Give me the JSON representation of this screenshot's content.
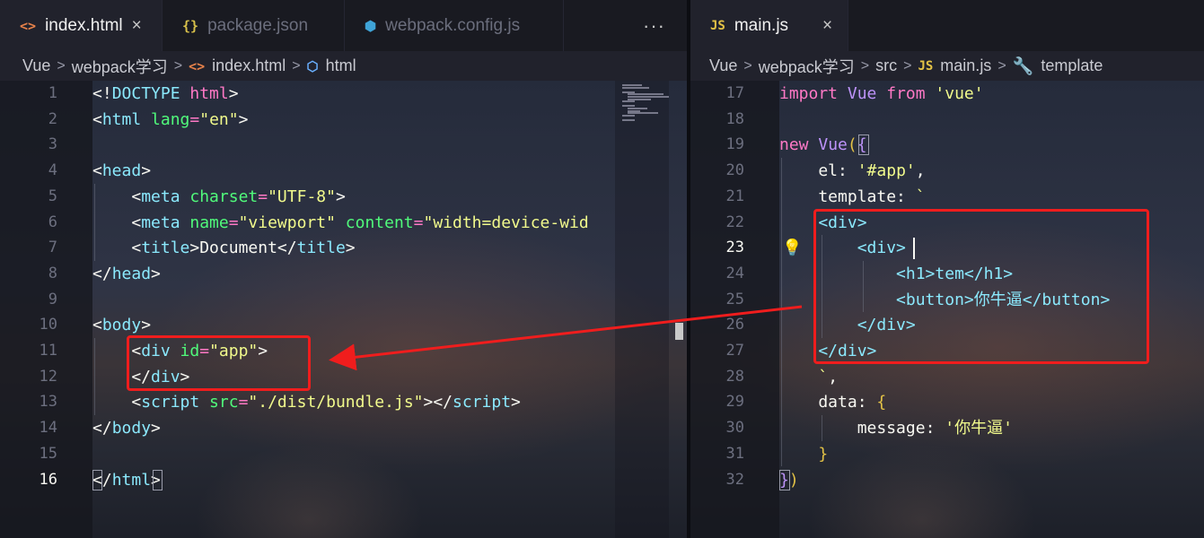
{
  "left": {
    "tabs": [
      {
        "label": "index.html",
        "icon": "<>",
        "icon_name": "html-file-icon",
        "active": true,
        "close": "×"
      },
      {
        "label": "package.json",
        "icon": "{}",
        "icon_name": "json-file-icon",
        "active": false
      },
      {
        "label": "webpack.config.js",
        "icon": "⬢",
        "icon_name": "webpack-config-icon",
        "active": false
      }
    ],
    "more_actions": "···",
    "breadcrumb": [
      "Vue",
      "webpack学习",
      "index.html",
      "html"
    ],
    "line_numbers": [
      "1",
      "2",
      "3",
      "4",
      "5",
      "6",
      "7",
      "8",
      "9",
      "10",
      "11",
      "12",
      "13",
      "14",
      "15",
      "16"
    ],
    "current_line": "16"
  },
  "right": {
    "tabs": [
      {
        "label": "main.js",
        "icon": "JS",
        "icon_name": "js-file-icon",
        "active": true,
        "close": "×"
      }
    ],
    "breadcrumb": [
      "Vue",
      "webpack学习",
      "src",
      "main.js",
      "template"
    ],
    "line_numbers": [
      "17",
      "18",
      "19",
      "20",
      "21",
      "22",
      "23",
      "24",
      "25",
      "26",
      "27",
      "28",
      "29",
      "30",
      "31",
      "32"
    ],
    "current_line": "23"
  },
  "colors": {
    "annotation_red": "#f01d1d",
    "tag": "#ff79c6",
    "attr": "#50fa7b",
    "string": "#f1fa8c",
    "keyword": "#ff79c6",
    "identifier": "#bd93f9",
    "template_tag": "#8be9fd"
  },
  "code_left": [
    [
      [
        "<!",
        "t-plain"
      ],
      [
        "DOCTYPE",
        "t-tag2"
      ],
      [
        " html",
        "t-tag"
      ],
      [
        ">",
        "t-plain"
      ]
    ],
    [
      [
        "<",
        "t-plain"
      ],
      [
        "html",
        "t-tag2"
      ],
      [
        " lang",
        "t-attr"
      ],
      [
        "=",
        "t-eq"
      ],
      [
        "\"en\"",
        "t-str"
      ],
      [
        ">",
        "t-plain"
      ]
    ],
    [],
    [
      [
        "<",
        "t-plain"
      ],
      [
        "head",
        "t-tag2"
      ],
      [
        ">",
        "t-plain"
      ]
    ],
    [
      [
        "    <",
        "t-plain"
      ],
      [
        "meta",
        "t-tag2"
      ],
      [
        " charset",
        "t-attr"
      ],
      [
        "=",
        "t-eq"
      ],
      [
        "\"UTF-8\"",
        "t-str"
      ],
      [
        ">",
        "t-plain"
      ]
    ],
    [
      [
        "    <",
        "t-plain"
      ],
      [
        "meta",
        "t-tag2"
      ],
      [
        " name",
        "t-attr"
      ],
      [
        "=",
        "t-eq"
      ],
      [
        "\"viewport\"",
        "t-str"
      ],
      [
        " content",
        "t-attr"
      ],
      [
        "=",
        "t-eq"
      ],
      [
        "\"width=device-wid",
        "t-str"
      ]
    ],
    [
      [
        "    <",
        "t-plain"
      ],
      [
        "title",
        "t-tag2"
      ],
      [
        ">",
        "t-plain"
      ],
      [
        "Document",
        "t-plain"
      ],
      [
        "</",
        "t-plain"
      ],
      [
        "title",
        "t-tag2"
      ],
      [
        ">",
        "t-plain"
      ]
    ],
    [
      [
        "</",
        "t-plain"
      ],
      [
        "head",
        "t-tag2"
      ],
      [
        ">",
        "t-plain"
      ]
    ],
    [],
    [
      [
        "<",
        "t-plain"
      ],
      [
        "body",
        "t-tag2"
      ],
      [
        ">",
        "t-plain"
      ]
    ],
    [
      [
        "    <",
        "t-plain"
      ],
      [
        "div",
        "t-tag2"
      ],
      [
        " id",
        "t-attr"
      ],
      [
        "=",
        "t-eq"
      ],
      [
        "\"app\"",
        "t-str"
      ],
      [
        ">",
        "t-plain"
      ]
    ],
    [
      [
        "    </",
        "t-plain"
      ],
      [
        "div",
        "t-tag2"
      ],
      [
        ">",
        "t-plain"
      ]
    ],
    [
      [
        "    <",
        "t-plain"
      ],
      [
        "script",
        "t-tag2"
      ],
      [
        " src",
        "t-attr"
      ],
      [
        "=",
        "t-eq"
      ],
      [
        "\"./dist/bundle.js\"",
        "t-str"
      ],
      [
        "></",
        "t-plain"
      ],
      [
        "script",
        "t-tag2"
      ],
      [
        ">",
        "t-plain"
      ]
    ],
    [
      [
        "</",
        "t-plain"
      ],
      [
        "body",
        "t-tag2"
      ],
      [
        ">",
        "t-plain"
      ]
    ],
    [],
    [
      [
        "</",
        "t-plain"
      ],
      [
        "html",
        "t-tag2"
      ],
      [
        ">",
        "t-plain"
      ]
    ]
  ],
  "code_right": [
    [
      [
        "import",
        "t-kw"
      ],
      [
        " Vue",
        "t-var"
      ],
      [
        " from",
        "t-kw"
      ],
      [
        " 'vue'",
        "t-str"
      ]
    ],
    [],
    [
      [
        "new",
        "t-kw"
      ],
      [
        " Vue",
        "t-var"
      ],
      [
        "(",
        "t-brkt"
      ],
      [
        "{",
        "t-var"
      ]
    ],
    [
      [
        "    el",
        "t-plain"
      ],
      [
        ": ",
        "t-plain"
      ],
      [
        "'#app'",
        "t-str"
      ],
      [
        ",",
        "t-plain"
      ]
    ],
    [
      [
        "    template",
        "t-plain"
      ],
      [
        ": ",
        "t-plain"
      ],
      [
        "`",
        "t-str"
      ]
    ],
    [
      [
        "    <div>",
        "t-tag2"
      ]
    ],
    [
      [
        "        <div>",
        "t-tag2"
      ]
    ],
    [
      [
        "            <h1>",
        "t-tag2"
      ],
      [
        "tem",
        "t-tag2"
      ],
      [
        "</h1>",
        "t-tag2"
      ]
    ],
    [
      [
        "            <button>",
        "t-tag2"
      ],
      [
        "你牛逼",
        "t-tag2"
      ],
      [
        "</button>",
        "t-tag2"
      ]
    ],
    [
      [
        "        </div>",
        "t-tag2"
      ]
    ],
    [
      [
        "    </div>",
        "t-tag2"
      ]
    ],
    [
      [
        "    `",
        "t-str"
      ],
      [
        ",",
        "t-plain"
      ]
    ],
    [
      [
        "    data",
        "t-plain"
      ],
      [
        ": ",
        "t-plain"
      ],
      [
        "{",
        "t-brkt"
      ]
    ],
    [
      [
        "        message",
        "t-plain"
      ],
      [
        ": ",
        "t-plain"
      ],
      [
        "'你牛逼'",
        "t-str"
      ]
    ],
    [
      [
        "    }",
        "t-brkt"
      ]
    ],
    [
      [
        "}",
        "t-var"
      ],
      [
        ")",
        "t-brkt"
      ]
    ]
  ]
}
